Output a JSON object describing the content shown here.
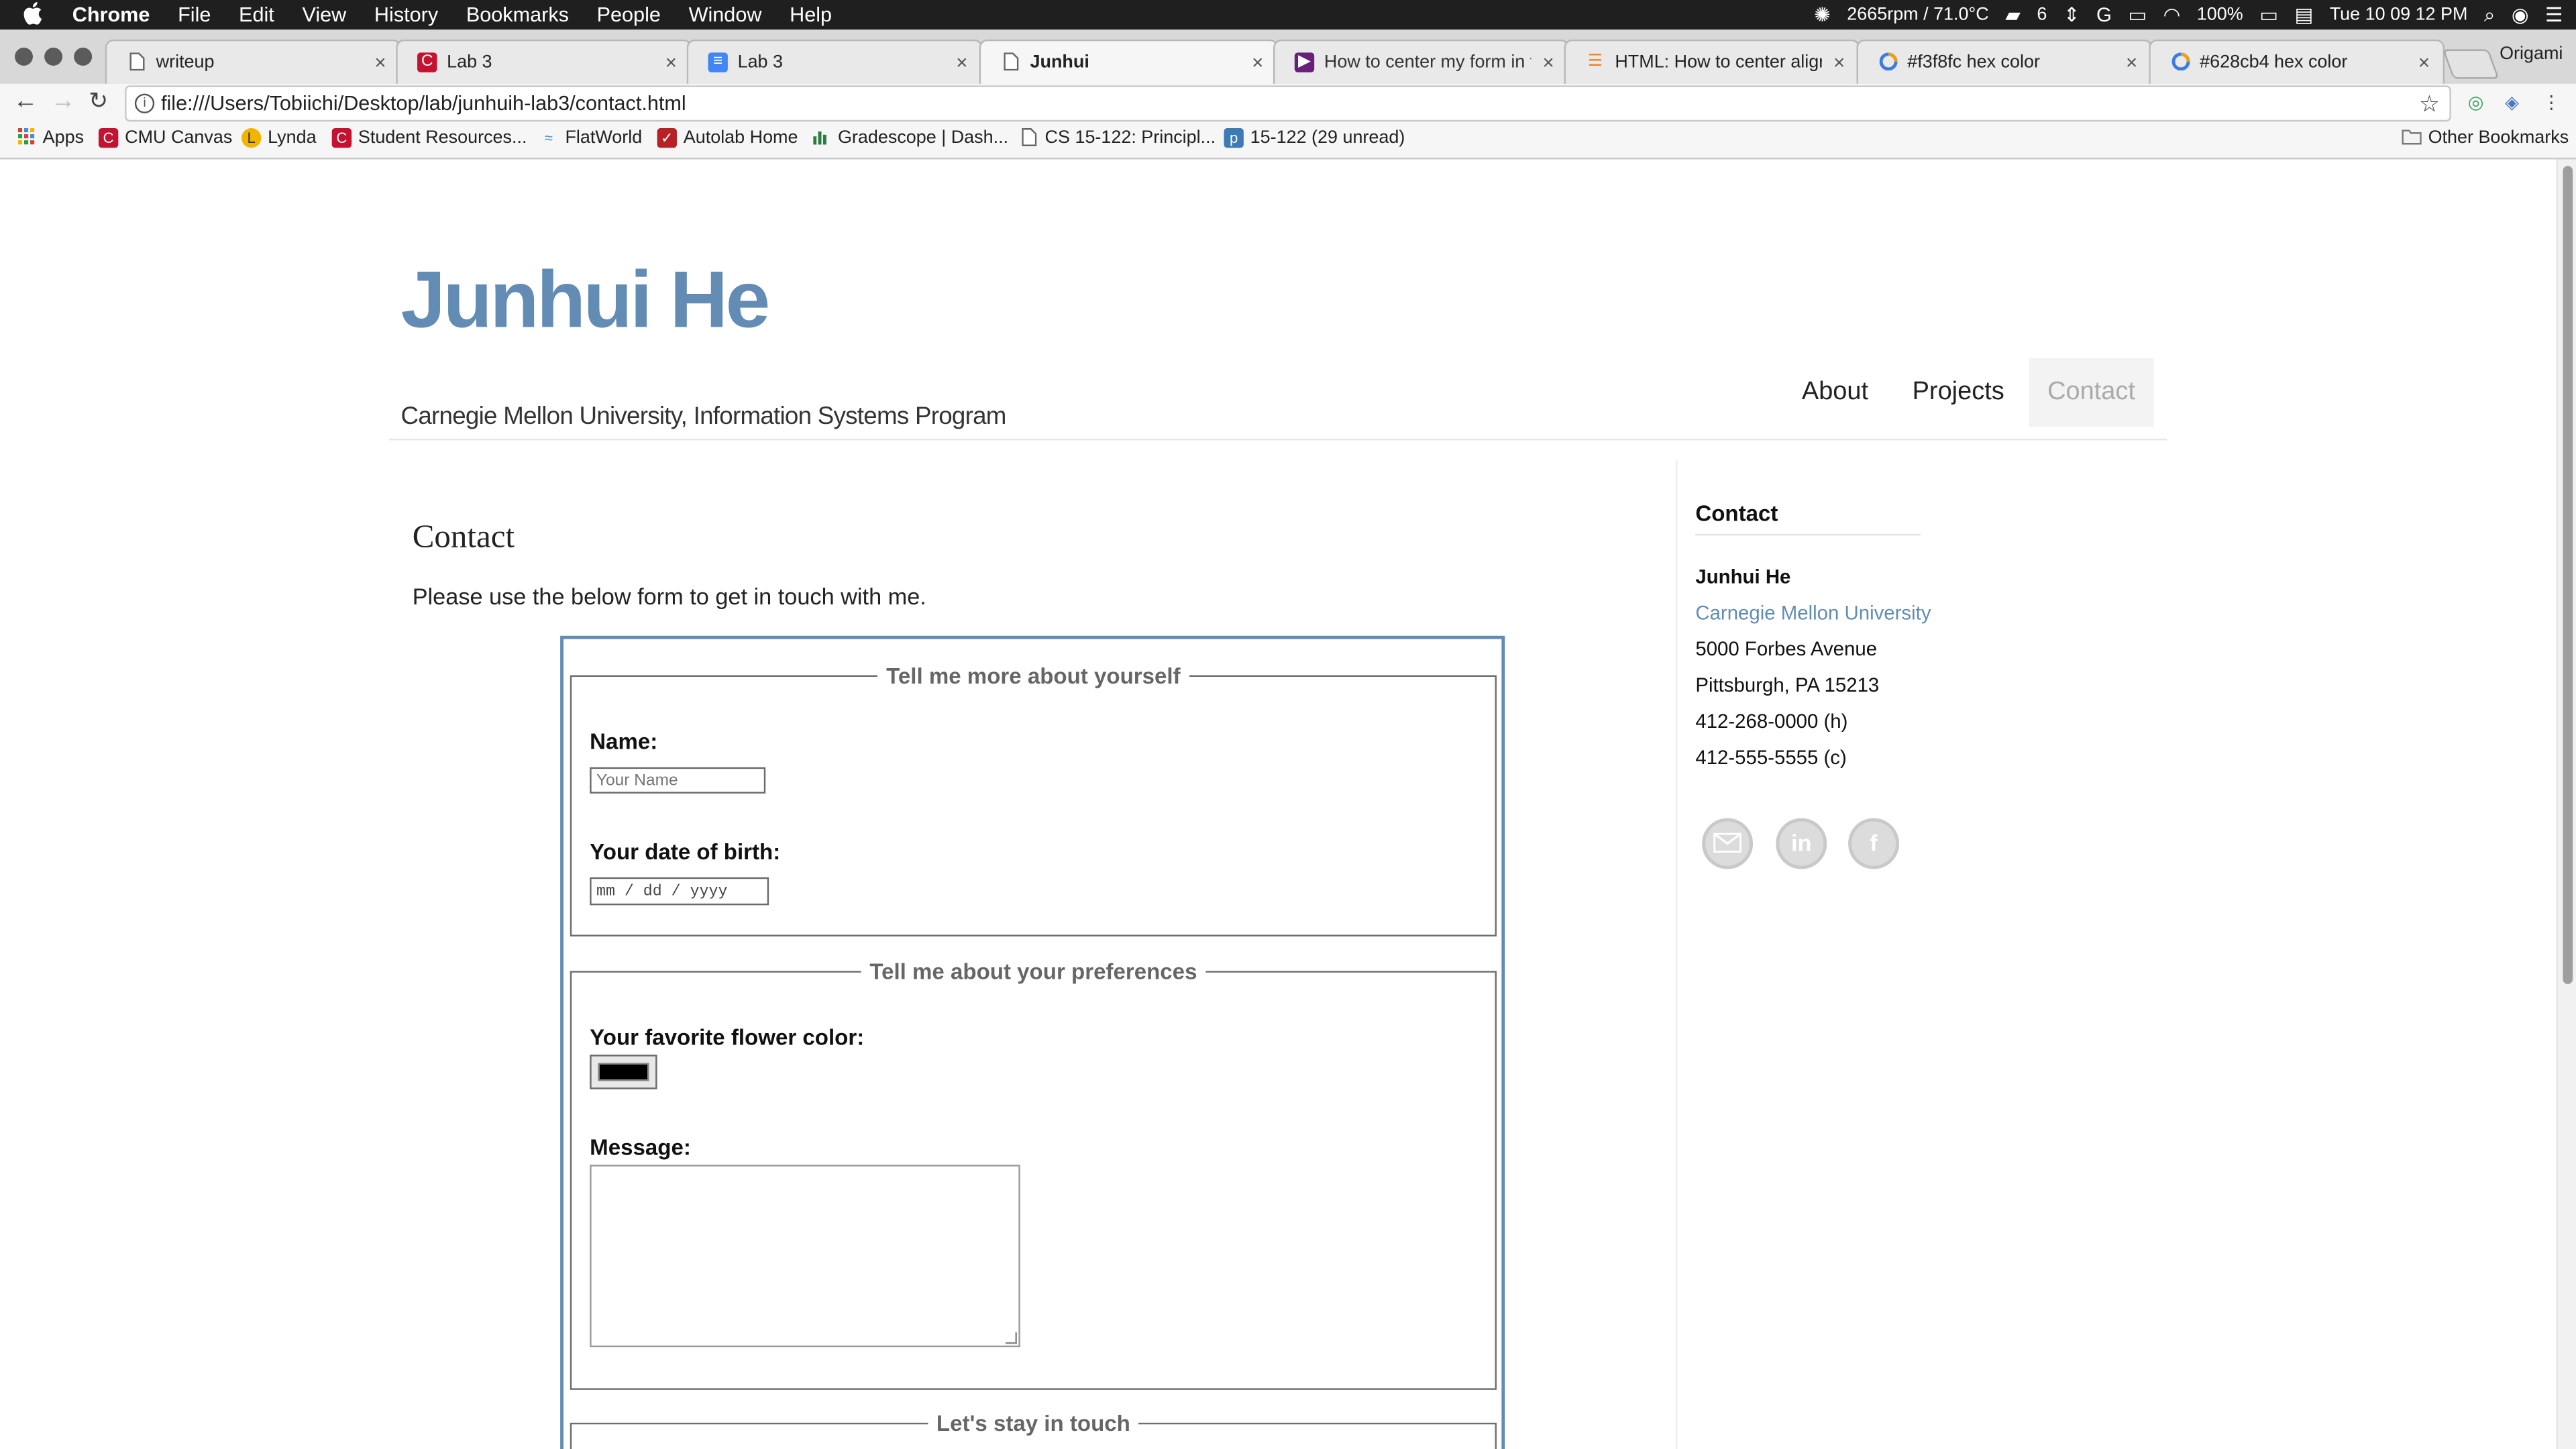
{
  "menubar": {
    "apple": "",
    "app_name": "Chrome",
    "menus": [
      "File",
      "Edit",
      "View",
      "History",
      "Bookmarks",
      "People",
      "Window",
      "Help"
    ],
    "status": {
      "fan": "2665rpm / 71.0°C",
      "badge": "6",
      "battery": "100%",
      "clock": "Tue 10 09 12 PM"
    }
  },
  "tabs": [
    {
      "title": "writeup",
      "icon": "page-icon"
    },
    {
      "title": "Lab 3",
      "icon": "canvas-icon"
    },
    {
      "title": "Lab 3",
      "icon": "docs-icon"
    },
    {
      "title": "Junhui",
      "icon": "page-icon",
      "active": true
    },
    {
      "title": "How to center my form in the",
      "icon": "visual-studio-icon"
    },
    {
      "title": "HTML: How to center align a",
      "icon": "stack-overflow-icon"
    },
    {
      "title": "#f3f8fc hex color",
      "icon": "color-hex-icon"
    },
    {
      "title": "#628cb4 hex color",
      "icon": "color-hex-icon"
    }
  ],
  "profile_name": "Origami",
  "toolbar": {
    "url": "file:///Users/Tobiichi/Desktop/lab/junhuih-lab3/contact.html"
  },
  "bookmarks": [
    {
      "label": "Apps",
      "icon": "apps-grid-icon",
      "color": "#d0452f"
    },
    {
      "label": "CMU Canvas",
      "icon": "canvas-icon",
      "color": "#c41230"
    },
    {
      "label": "Lynda",
      "icon": "lynda-icon",
      "color": "#f1b400"
    },
    {
      "label": "Student Resources...",
      "icon": "canvas-icon",
      "color": "#c41230"
    },
    {
      "label": "FlatWorld",
      "icon": "flatworld-icon",
      "color": "#4a8ad0"
    },
    {
      "label": "Autolab Home",
      "icon": "autolab-icon",
      "color": "#b72126"
    },
    {
      "label": "Gradescope | Dash...",
      "icon": "gradescope-icon",
      "color": "#2a7d3f"
    },
    {
      "label": "CS 15-122: Principl...",
      "icon": "page-icon",
      "color": "#ffffff"
    },
    {
      "label": "15-122 (29 unread)",
      "icon": "piazza-icon",
      "color": "#3e7ab6"
    }
  ],
  "other_bookmarks": "Other Bookmarks",
  "site": {
    "title": "Junhui He",
    "subtitle": "Carnegie Mellon University, Information Systems Program",
    "accent_color": "#628cb4",
    "nav": [
      "About",
      "Projects",
      "Contact"
    ]
  },
  "content": {
    "heading": "Contact",
    "intro": "Please use the below form to get in touch with me.",
    "form": {
      "fieldset1_legend": "Tell me more about yourself",
      "name_label": "Name:",
      "name_placeholder": "Your Name",
      "dob_label": "Your date of birth:",
      "dob_placeholder": "mm / dd / yyyy",
      "fieldset2_legend": "Tell me about your preferences",
      "flower_label": "Your favorite flower color:",
      "flower_value": "#000000",
      "message_label": "Message:",
      "fieldset3_legend": "Let's stay in touch"
    }
  },
  "sidebar": {
    "heading": "Contact",
    "name": "Junhui He",
    "university": "Carnegie Mellon University",
    "street": "5000 Forbes Avenue",
    "city": "Pittsburgh, PA 15213",
    "phone_home": "412-268-0000 (h)",
    "phone_cell": "412-555-5555 (c)",
    "social": [
      "email-icon",
      "linkedin-icon",
      "facebook-icon"
    ]
  }
}
